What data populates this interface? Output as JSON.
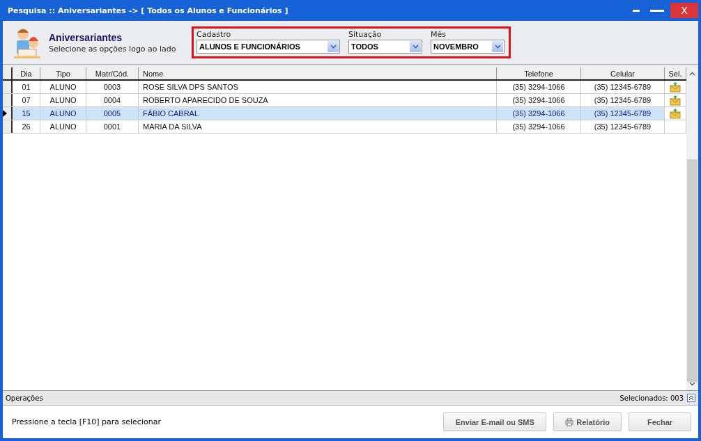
{
  "window": {
    "title": "Pesquisa :: Aniversariantes -> [ Todos os Alunos e Funcionários ]",
    "close_label": "X"
  },
  "header": {
    "title": "Aniversariantes",
    "subtitle": "Selecione as opções logo ao lado"
  },
  "filters": [
    {
      "label": "Cadastro",
      "value": "ALUNOS E FUNCIONÁRIOS"
    },
    {
      "label": "Situação",
      "value": "TODOS"
    },
    {
      "label": "Mês",
      "value": "NOVEMBRO"
    }
  ],
  "table": {
    "columns": [
      "Dia",
      "Tipo",
      "Matr/Cód.",
      "Nome",
      "Telefone",
      "Celular",
      "Sel."
    ],
    "rows": [
      {
        "cells": [
          "01",
          "ALUNO",
          "0003",
          "ROSE SILVA DPS SANTOS",
          "(35) 3294-1066",
          "(35) 12345-6789"
        ],
        "marked": true,
        "selected": false
      },
      {
        "cells": [
          "07",
          "ALUNO",
          "0004",
          "ROBERTO APARECIDO DE SOUZA",
          "(35) 3294-1066",
          "(35) 12345-6789"
        ],
        "marked": true,
        "selected": false
      },
      {
        "cells": [
          "15",
          "ALUNO",
          "0005",
          "FÁBIO CABRAL",
          "(35) 3294-1066",
          "(35) 12345-6789"
        ],
        "marked": true,
        "selected": true
      },
      {
        "cells": [
          "26",
          "ALUNO",
          "0001",
          "MARIA DA SILVA",
          "(35) 3294-1066",
          "(35) 12345-6789"
        ],
        "marked": false,
        "selected": false
      }
    ]
  },
  "operations": {
    "label": "Operações",
    "count": "Selecionados: 003"
  },
  "footer": {
    "hint": "Pressione a tecla [F10] para selecionar",
    "buttons": [
      "Enviar E-mail ou SMS",
      "Relatório",
      "Fechar"
    ]
  }
}
